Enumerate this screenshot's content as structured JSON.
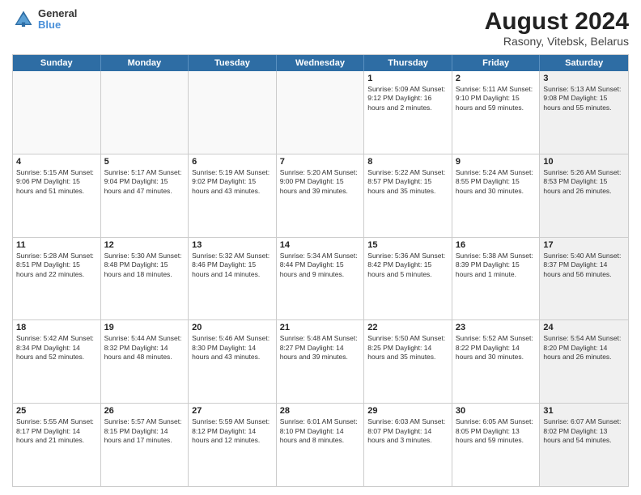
{
  "header": {
    "logo_line1": "General",
    "logo_line2": "Blue",
    "title": "August 2024",
    "subtitle": "Rasony, Vitebsk, Belarus"
  },
  "weekdays": [
    "Sunday",
    "Monday",
    "Tuesday",
    "Wednesday",
    "Thursday",
    "Friday",
    "Saturday"
  ],
  "rows": [
    [
      {
        "day": "",
        "info": "",
        "empty": true
      },
      {
        "day": "",
        "info": "",
        "empty": true
      },
      {
        "day": "",
        "info": "",
        "empty": true
      },
      {
        "day": "",
        "info": "",
        "empty": true
      },
      {
        "day": "1",
        "info": "Sunrise: 5:09 AM\nSunset: 9:12 PM\nDaylight: 16 hours\nand 2 minutes."
      },
      {
        "day": "2",
        "info": "Sunrise: 5:11 AM\nSunset: 9:10 PM\nDaylight: 15 hours\nand 59 minutes."
      },
      {
        "day": "3",
        "info": "Sunrise: 5:13 AM\nSunset: 9:08 PM\nDaylight: 15 hours\nand 55 minutes.",
        "shaded": true
      }
    ],
    [
      {
        "day": "4",
        "info": "Sunrise: 5:15 AM\nSunset: 9:06 PM\nDaylight: 15 hours\nand 51 minutes."
      },
      {
        "day": "5",
        "info": "Sunrise: 5:17 AM\nSunset: 9:04 PM\nDaylight: 15 hours\nand 47 minutes."
      },
      {
        "day": "6",
        "info": "Sunrise: 5:19 AM\nSunset: 9:02 PM\nDaylight: 15 hours\nand 43 minutes."
      },
      {
        "day": "7",
        "info": "Sunrise: 5:20 AM\nSunset: 9:00 PM\nDaylight: 15 hours\nand 39 minutes."
      },
      {
        "day": "8",
        "info": "Sunrise: 5:22 AM\nSunset: 8:57 PM\nDaylight: 15 hours\nand 35 minutes."
      },
      {
        "day": "9",
        "info": "Sunrise: 5:24 AM\nSunset: 8:55 PM\nDaylight: 15 hours\nand 30 minutes."
      },
      {
        "day": "10",
        "info": "Sunrise: 5:26 AM\nSunset: 8:53 PM\nDaylight: 15 hours\nand 26 minutes.",
        "shaded": true
      }
    ],
    [
      {
        "day": "11",
        "info": "Sunrise: 5:28 AM\nSunset: 8:51 PM\nDaylight: 15 hours\nand 22 minutes."
      },
      {
        "day": "12",
        "info": "Sunrise: 5:30 AM\nSunset: 8:48 PM\nDaylight: 15 hours\nand 18 minutes."
      },
      {
        "day": "13",
        "info": "Sunrise: 5:32 AM\nSunset: 8:46 PM\nDaylight: 15 hours\nand 14 minutes."
      },
      {
        "day": "14",
        "info": "Sunrise: 5:34 AM\nSunset: 8:44 PM\nDaylight: 15 hours\nand 9 minutes."
      },
      {
        "day": "15",
        "info": "Sunrise: 5:36 AM\nSunset: 8:42 PM\nDaylight: 15 hours\nand 5 minutes."
      },
      {
        "day": "16",
        "info": "Sunrise: 5:38 AM\nSunset: 8:39 PM\nDaylight: 15 hours\nand 1 minute."
      },
      {
        "day": "17",
        "info": "Sunrise: 5:40 AM\nSunset: 8:37 PM\nDaylight: 14 hours\nand 56 minutes.",
        "shaded": true
      }
    ],
    [
      {
        "day": "18",
        "info": "Sunrise: 5:42 AM\nSunset: 8:34 PM\nDaylight: 14 hours\nand 52 minutes."
      },
      {
        "day": "19",
        "info": "Sunrise: 5:44 AM\nSunset: 8:32 PM\nDaylight: 14 hours\nand 48 minutes."
      },
      {
        "day": "20",
        "info": "Sunrise: 5:46 AM\nSunset: 8:30 PM\nDaylight: 14 hours\nand 43 minutes."
      },
      {
        "day": "21",
        "info": "Sunrise: 5:48 AM\nSunset: 8:27 PM\nDaylight: 14 hours\nand 39 minutes."
      },
      {
        "day": "22",
        "info": "Sunrise: 5:50 AM\nSunset: 8:25 PM\nDaylight: 14 hours\nand 35 minutes."
      },
      {
        "day": "23",
        "info": "Sunrise: 5:52 AM\nSunset: 8:22 PM\nDaylight: 14 hours\nand 30 minutes."
      },
      {
        "day": "24",
        "info": "Sunrise: 5:54 AM\nSunset: 8:20 PM\nDaylight: 14 hours\nand 26 minutes.",
        "shaded": true
      }
    ],
    [
      {
        "day": "25",
        "info": "Sunrise: 5:55 AM\nSunset: 8:17 PM\nDaylight: 14 hours\nand 21 minutes."
      },
      {
        "day": "26",
        "info": "Sunrise: 5:57 AM\nSunset: 8:15 PM\nDaylight: 14 hours\nand 17 minutes."
      },
      {
        "day": "27",
        "info": "Sunrise: 5:59 AM\nSunset: 8:12 PM\nDaylight: 14 hours\nand 12 minutes."
      },
      {
        "day": "28",
        "info": "Sunrise: 6:01 AM\nSunset: 8:10 PM\nDaylight: 14 hours\nand 8 minutes."
      },
      {
        "day": "29",
        "info": "Sunrise: 6:03 AM\nSunset: 8:07 PM\nDaylight: 14 hours\nand 3 minutes."
      },
      {
        "day": "30",
        "info": "Sunrise: 6:05 AM\nSunset: 8:05 PM\nDaylight: 13 hours\nand 59 minutes."
      },
      {
        "day": "31",
        "info": "Sunrise: 6:07 AM\nSunset: 8:02 PM\nDaylight: 13 hours\nand 54 minutes.",
        "shaded": true
      }
    ]
  ]
}
